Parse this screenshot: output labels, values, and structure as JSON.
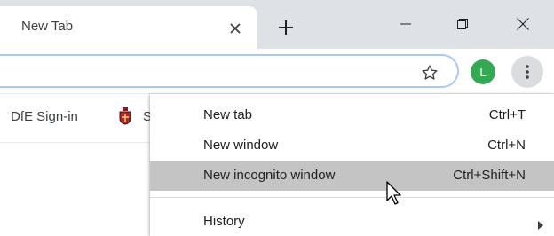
{
  "tab": {
    "title": "New Tab",
    "close_icon": "close-icon",
    "new_tab_icon": "plus-icon"
  },
  "window_controls": {
    "minimize_icon": "minimize-icon",
    "restore_icon": "restore-icon",
    "close_icon": "close-icon"
  },
  "toolbar": {
    "bookmark_star_icon": "star-icon",
    "profile_initial": "L",
    "profile_color": "#34a853",
    "menu_icon": "kebab-icon"
  },
  "bookmarks": {
    "items": [
      {
        "label": "DfE Sign-in"
      },
      {
        "icon": "crest-icon",
        "label_partial": "S"
      }
    ]
  },
  "menu": {
    "items": [
      {
        "label": "New tab",
        "shortcut": "Ctrl+T"
      },
      {
        "label": "New window",
        "shortcut": "Ctrl+N"
      },
      {
        "label": "New incognito window",
        "shortcut": "Ctrl+Shift+N",
        "highlighted": true
      },
      {
        "label": "History",
        "submenu": true
      }
    ],
    "highlight_color": "#c4c4c4"
  },
  "accent_colors": {
    "omnibox_focus_border": "#a8c7fa",
    "tabstrip_background": "#dee1e6"
  }
}
